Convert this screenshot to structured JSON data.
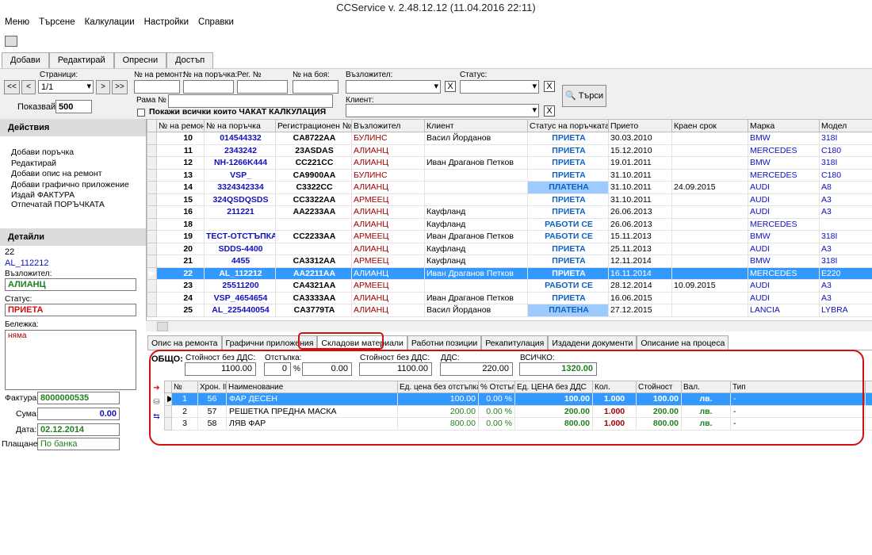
{
  "title": "CCService v. 2.48.12.12 (11.04.2016 22:11)",
  "menu": [
    "Меню",
    "Търсене",
    "Калкулации",
    "Настройки",
    "Справки"
  ],
  "action_tabs": [
    "Добави",
    "Редактирай",
    "Опресни",
    "Достъп"
  ],
  "filters": {
    "pages_label": "Страници:",
    "page_value": "1/1",
    "show_label": "Показвай",
    "show_value": "500",
    "repair_no_label": "№ на ремонт:",
    "order_no_label": "№ на поръчка:",
    "reg_no_label": "Рег. №",
    "paint_no_label": "№ на боя:",
    "frame_label": "Рама №",
    "insurer_label": "Възложител:",
    "status_label": "Статус:",
    "client_label": "Клиент:",
    "show_all_label": "Покажи всички които ЧАКАТ КАЛКУЛАЦИЯ",
    "search_label": "Търси",
    "nav_first": "<<",
    "nav_prev": "<",
    "nav_next": ">",
    "nav_last": ">>",
    "clear_x": "X"
  },
  "actions": {
    "header": "Действия",
    "items": [
      "Добави поръчка",
      "Редактирай",
      "Добави опис на ремонт",
      "Добави графично приложение",
      "Издай ФАКТУРА",
      "Отпечатай ПОРЪЧКАТА"
    ]
  },
  "details": {
    "header": "Детайли",
    "id": "22",
    "order": "AL_112212",
    "insurer_label": "Възложител:",
    "insurer": "АЛИАНЦ",
    "status_label": "Статус:",
    "status": "ПРИЕТА",
    "note_label": "Бележка:",
    "note": "няма",
    "invoice_label": "Фактура",
    "invoice": "8000000535",
    "amount_label": "Сума:",
    "amount": "0.00",
    "date_label": "Дата:",
    "date": "02.12.2014",
    "payment_label": "Плащане:",
    "payment": "По банка"
  },
  "grid": {
    "columns": [
      "№ на ремонт",
      "№ на поръчка",
      "Регистрационен №",
      "Възложител",
      "Клиент",
      "Статус на поръчката",
      "Прието",
      "Краен срок",
      "Марка",
      "Модел"
    ],
    "rows": [
      [
        "10",
        "014544332",
        "CA8722AA",
        "БУЛИНС",
        "Васил Йорданов",
        "ПРИЕТА",
        "30.03.2010",
        "",
        "BMW",
        "318I"
      ],
      [
        "11",
        "2343242",
        "23ASDAS",
        "АЛИАНЦ",
        "",
        "ПРИЕТА",
        "15.12.2010",
        "",
        "MERCEDES",
        "C180"
      ],
      [
        "12",
        "NH-1266K444",
        "CC221CC",
        "АЛИАНЦ",
        "Иван Драганов Петков",
        "ПРИЕТА",
        "19.01.2011",
        "",
        "BMW",
        "318I"
      ],
      [
        "13",
        "VSP_",
        "CA9900AA",
        "БУЛИНС",
        "",
        "ПРИЕТА",
        "31.10.2011",
        "",
        "MERCEDES",
        "C180"
      ],
      [
        "14",
        "3324342334",
        "C3322CC",
        "АЛИАНЦ",
        "",
        "ПЛАТЕНА",
        "31.10.2011",
        "24.09.2015",
        "AUDI",
        "A8"
      ],
      [
        "15",
        "324QSDQSDS",
        "CC3322AA",
        "АРМЕЕЦ",
        "",
        "ПРИЕТА",
        "31.10.2011",
        "",
        "AUDI",
        "A3"
      ],
      [
        "16",
        "211221",
        "AA2233AA",
        "АЛИАНЦ",
        "Кауфланд",
        "ПРИЕТА",
        "26.06.2013",
        "",
        "AUDI",
        "A3"
      ],
      [
        "18",
        "",
        "",
        "АЛИАНЦ",
        "Кауфланд",
        "РАБОТИ СЕ",
        "26.06.2013",
        "",
        "MERCEDES",
        ""
      ],
      [
        "19",
        "ТЕСТ-ОТСТЪПКА",
        "CC2233AA",
        "АРМЕЕЦ",
        "Иван Драганов Петков",
        "РАБОТИ СЕ",
        "15.11.2013",
        "",
        "BMW",
        "318I"
      ],
      [
        "20",
        "SDDS-4400",
        "",
        "АЛИАНЦ",
        "Кауфланд",
        "ПРИЕТА",
        "25.11.2013",
        "",
        "AUDI",
        "A3"
      ],
      [
        "21",
        "4455",
        "CA3312AA",
        "АРМЕЕЦ",
        "Кауфланд",
        "ПРИЕТА",
        "12.11.2014",
        "",
        "BMW",
        "318I"
      ],
      [
        "22",
        "AL_112212",
        "AA2211AA",
        "АЛИАНЦ",
        "Иван Драганов Петков",
        "ПРИЕТА",
        "16.11.2014",
        "",
        "MERCEDES",
        "E220"
      ],
      [
        "23",
        "25511200",
        "CA4321AA",
        "АРМЕЕЦ",
        "",
        "РАБОТИ СЕ",
        "28.12.2014",
        "10.09.2015",
        "AUDI",
        "A3"
      ],
      [
        "24",
        "VSP_4654654",
        "CA3333AA",
        "АЛИАНЦ",
        "Иван Драганов Петков",
        "ПРИЕТА",
        "16.06.2015",
        "",
        "AUDI",
        "A3"
      ],
      [
        "25",
        "AL_225440054",
        "CA3779TA",
        "АЛИАНЦ",
        "Васил Йорданов",
        "ПЛАТЕНА",
        "27.12.2015",
        "",
        "LANCIA",
        "LYBRA"
      ]
    ],
    "selected_row": 11
  },
  "subtabs": [
    "Опис на ремонта",
    "Графични приложения",
    "Складови материали",
    "Работни позиции",
    "Рекапитулация",
    "Издадени документи",
    "Описание на процеса"
  ],
  "active_subtab": 2,
  "totals": {
    "label": "ОБЩО:",
    "net_label": "Стойност без ДДС:",
    "net": "1100.00",
    "discount_label": "Отстъпка:",
    "discount_pct": "0",
    "pct_sign": "%",
    "discount_amt": "0.00",
    "net2_label": "Стойност без ДДС:",
    "net2": "1100.00",
    "vat_label": "ДДС:",
    "vat": "220.00",
    "total_label": "ВСИЧКО:",
    "total": "1320.00"
  },
  "materials": {
    "columns": [
      "№",
      "Хрон. ID",
      "Наименование",
      "Ед. цена без отстъпка",
      "% Отстъпка",
      "Ед. ЦЕНА без ДДС",
      "Кол.",
      "Стойност",
      "Вал.",
      "Тип"
    ],
    "rows": [
      [
        "1",
        "56",
        "ФАР ДЕСЕН",
        "100.00",
        "0.00 %",
        "100.00",
        "1.000",
        "100.00",
        "лв.",
        "-"
      ],
      [
        "2",
        "57",
        "РЕШЕТКА ПРЕДНА МАСКА",
        "200.00",
        "0.00 %",
        "200.00",
        "1.000",
        "200.00",
        "лв.",
        "-"
      ],
      [
        "3",
        "58",
        "ЛЯВ ФАР",
        "800.00",
        "0.00 %",
        "800.00",
        "1.000",
        "800.00",
        "лв.",
        "-"
      ]
    ],
    "selected_row": 0
  }
}
